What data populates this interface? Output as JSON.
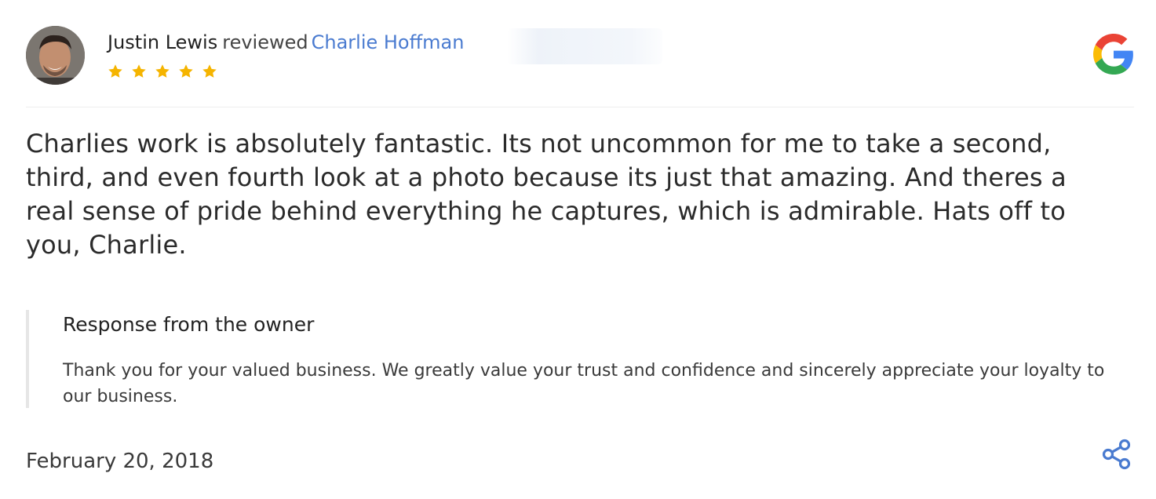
{
  "review": {
    "reviewer_name": "Justin Lewis",
    "reviewed_word": "reviewed",
    "business_name": "Charlie Hoffman",
    "rating": 5,
    "rating_max": 5,
    "text": "Charlies work is absolutely fantastic. Its not uncommon for me to take a second, third, and even fourth look at a photo because its just that amazing. And theres a real sense of pride behind everything he captures, which is admirable. Hats off to you, Charlie.",
    "date": "February 20, 2018"
  },
  "owner_response": {
    "title": "Response from the owner",
    "text": "Thank you for your valued business. We greatly value your trust and confidence and sincerely appreciate your loyalty to our business."
  },
  "icons": {
    "platform": "google-icon",
    "star": "star-icon",
    "share": "share-icon"
  },
  "colors": {
    "link": "#4a7bd0",
    "star": "#f5b400",
    "share": "#4a7bd0",
    "google_blue": "#4285F4",
    "google_red": "#EA4335",
    "google_yellow": "#FBBC05",
    "google_green": "#34A853"
  }
}
